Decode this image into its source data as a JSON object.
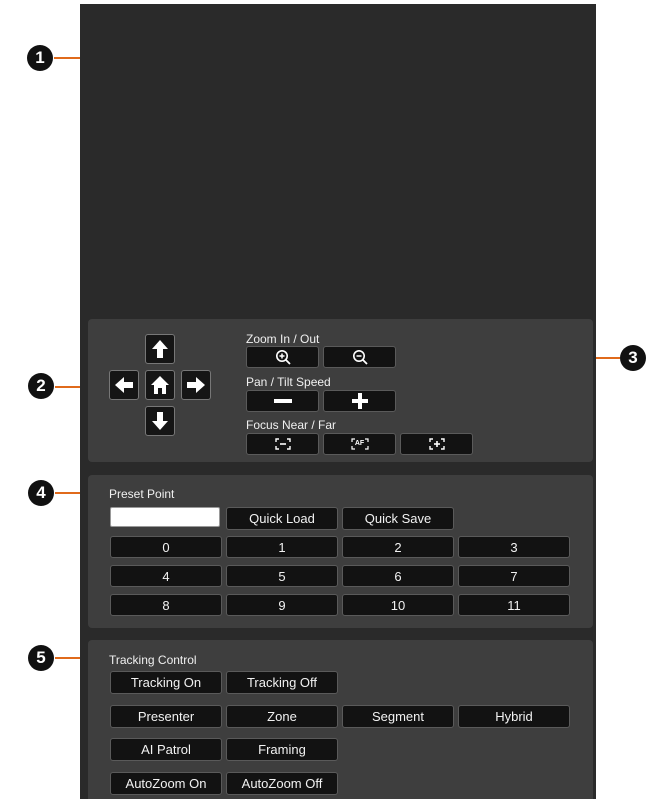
{
  "callouts": [
    "1",
    "2",
    "3",
    "4",
    "5"
  ],
  "ptz": {
    "zoom_label": "Zoom In / Out",
    "pan_tilt_label": "Pan / Tilt Speed",
    "focus_label": "Focus Near / Far",
    "focus_auto_text": "AF"
  },
  "preset": {
    "title": "Preset Point",
    "input_value": "",
    "quick_load": "Quick Load",
    "quick_save": "Quick Save",
    "numbers": [
      "0",
      "1",
      "2",
      "3",
      "4",
      "5",
      "6",
      "7",
      "8",
      "9",
      "10",
      "11"
    ]
  },
  "tracking": {
    "title": "Tracking Control",
    "buttons": [
      "Tracking On",
      "Tracking Off",
      "Presenter",
      "Zone",
      "Segment",
      "Hybrid",
      "AI Patrol",
      "Framing",
      "AutoZoom On",
      "AutoZoom Off"
    ]
  },
  "colors": {
    "accent": "#e06a1b",
    "panel": "#3e3e3e",
    "frame": "#2a2a2a",
    "button": "#121212"
  },
  "icons": [
    "zoom-in-icon",
    "zoom-out-icon",
    "minus-icon",
    "plus-icon",
    "focus-near-icon",
    "auto-focus-icon",
    "focus-far-icon",
    "arrow-up-icon",
    "arrow-down-icon",
    "arrow-left-icon",
    "arrow-right-icon",
    "home-icon"
  ]
}
